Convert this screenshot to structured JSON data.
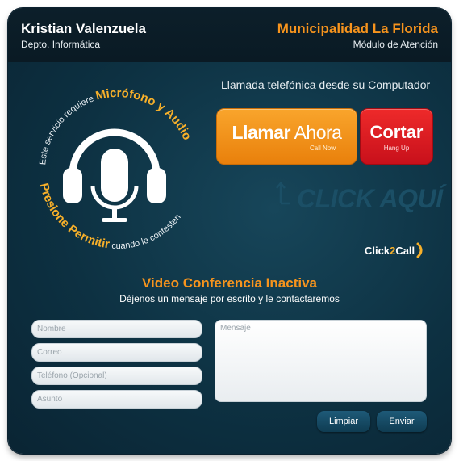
{
  "header": {
    "agent_name": "Kristian Valenzuela",
    "agent_department": "Depto. Informática",
    "organization": "Municipalidad La Florida",
    "module": "Módulo de Atención"
  },
  "mic_panel": {
    "top_text_normal": "Este servicio requiere ",
    "top_text_highlight": "Micrófono y Audio",
    "bottom_text_highlight": "Presione Permitir",
    "bottom_text_normal": " cuando le contesten",
    "icon": "headset-microphone-icon"
  },
  "call": {
    "title": "Llamada telefónica desde su Computador",
    "call_button": {
      "bold": "Llamar",
      "light": " Ahora",
      "sub": "Call Now"
    },
    "hangup_button": {
      "label": "Cortar",
      "sub": "Hang Up"
    },
    "click_here": "CLICK AQUÍ",
    "brand_part1": "Click",
    "brand_part2": "2",
    "brand_part3": "Call"
  },
  "video": {
    "title": "Video Conferencia Inactiva",
    "subtitle": "Déjenos un mensaje por escrito y le contactaremos"
  },
  "form": {
    "name_placeholder": "Nombre",
    "email_placeholder": "Correo",
    "phone_placeholder": "Teléfono (Opcional)",
    "subject_placeholder": "Asunto",
    "message_placeholder": "Mensaje",
    "clear_label": "Limpiar",
    "send_label": "Enviar"
  },
  "colors": {
    "accent": "#f7941d",
    "panel_bg": "#0d3142",
    "hangup": "#d7141f",
    "button_blue": "#15475f"
  }
}
